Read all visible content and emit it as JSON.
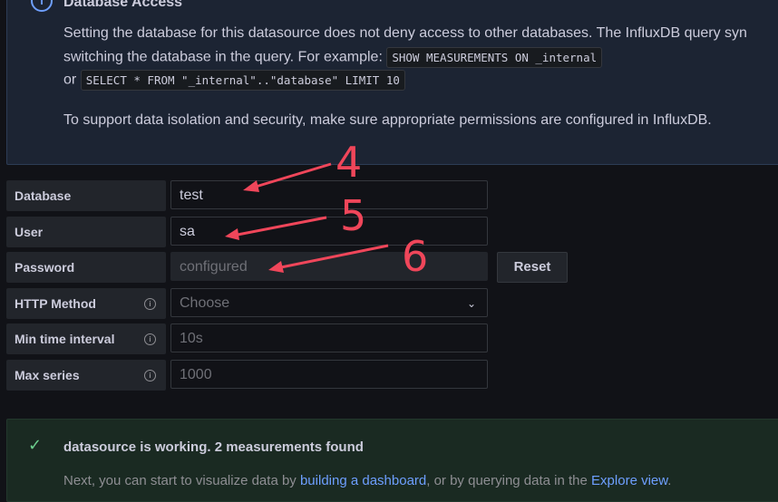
{
  "info": {
    "icon": "info-icon",
    "title": "Database Access",
    "line1": "Setting the database for this datasource does not deny access to other databases. The InfluxDB query syn",
    "line2_text": "switching the database in the query. For example:",
    "code1": "SHOW MEASUREMENTS ON _internal",
    "line3_text": "or",
    "code2": "SELECT * FROM \"_internal\"..\"database\" LIMIT 10",
    "line4": "To support data isolation and security, make sure appropriate permissions are configured in InfluxDB."
  },
  "fields": {
    "database": {
      "label": "Database",
      "value": "test"
    },
    "user": {
      "label": "User",
      "value": "sa"
    },
    "password": {
      "label": "Password",
      "value": "configured"
    },
    "http_method": {
      "label": "HTTP Method",
      "placeholder": "Choose"
    },
    "min_time_interval": {
      "label": "Min time interval",
      "placeholder": "10s"
    },
    "max_series": {
      "label": "Max series",
      "placeholder": "1000"
    }
  },
  "buttons": {
    "reset": "Reset"
  },
  "success": {
    "title": "datasource is working. 2 measurements found",
    "text_before": "Next, you can start to visualize data by",
    "link1": "building a dashboard",
    "text_middle": ", or by querying data in the",
    "link2": "Explore view",
    "text_after": "."
  },
  "annotations": [
    "4",
    "5",
    "6"
  ],
  "colors": {
    "accent": "#6e9fff",
    "success": "#6ccf8e",
    "annotation": "#f0465a"
  }
}
